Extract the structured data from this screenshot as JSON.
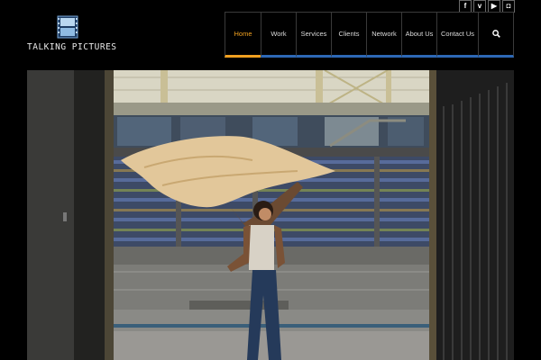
{
  "brand": {
    "logo_text": "TALKING PICTURES"
  },
  "social": [
    {
      "icon": "facebook-icon",
      "glyph": "f"
    },
    {
      "icon": "vimeo-icon",
      "glyph": "v"
    },
    {
      "icon": "youtube-icon",
      "glyph": "▶"
    },
    {
      "icon": "instagram-icon",
      "glyph": "◘"
    }
  ],
  "nav": {
    "home": "Home",
    "work": "Work",
    "services": "Services",
    "clients": "Clients",
    "network": "Network",
    "about": "About Us",
    "contact": "Contact Us"
  },
  "colors": {
    "accent": "#f0a020",
    "nav_underline": "#2d68b5",
    "background": "#000000"
  }
}
